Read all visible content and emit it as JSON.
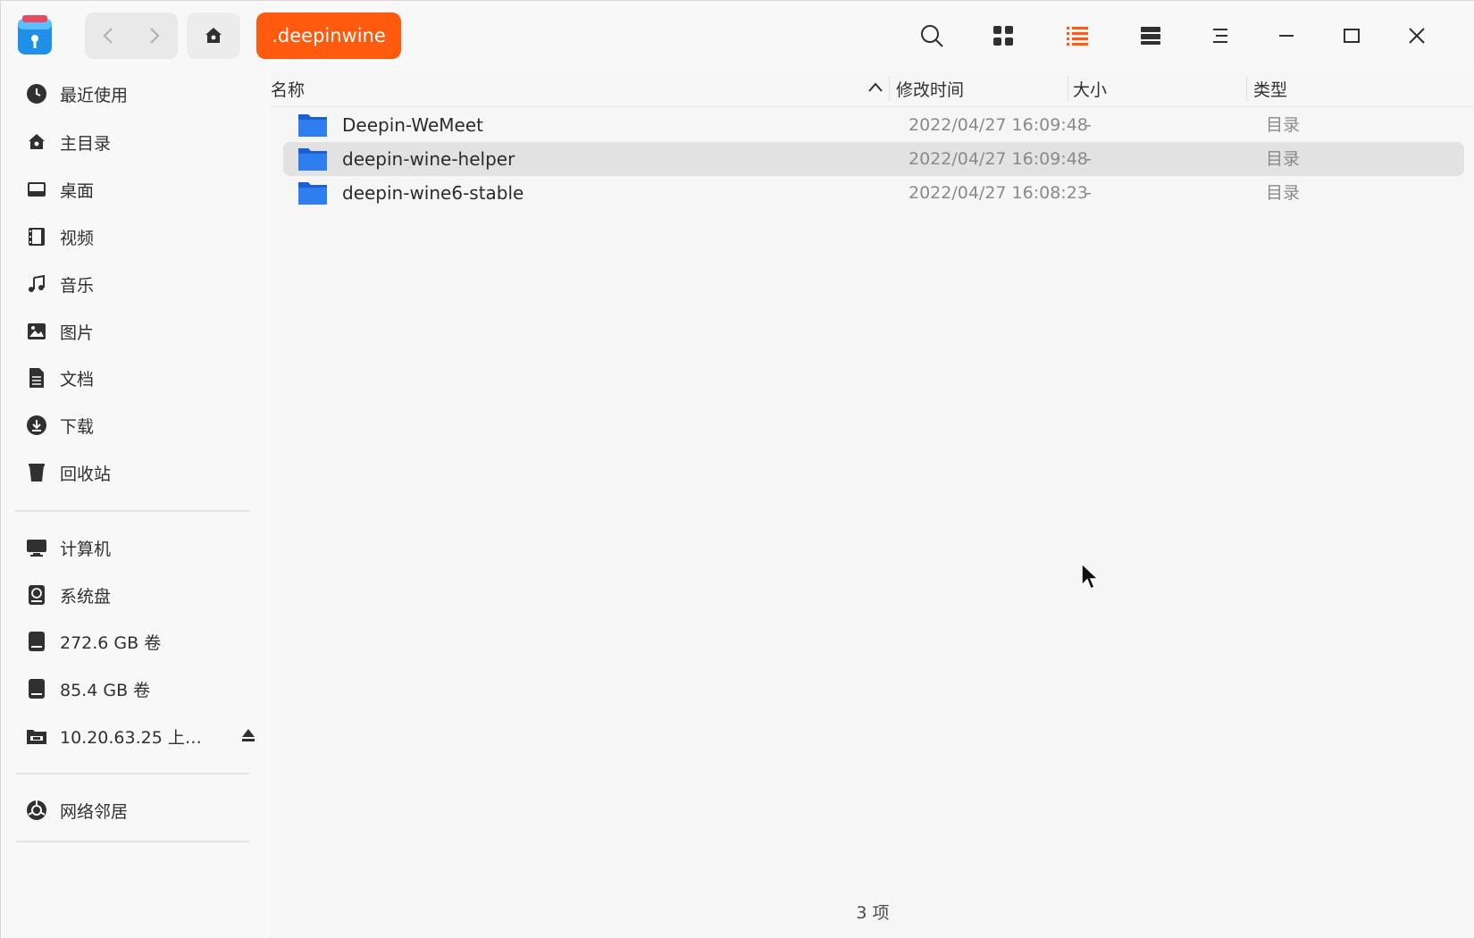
{
  "titlebar": {
    "breadcrumb": ".deepinwine",
    "icons": [
      "back-icon",
      "forward-icon",
      "home-icon",
      "search-icon",
      "icon-view-icon",
      "list-view-icon",
      "detail-view-icon",
      "menu-icon",
      "minimize-icon",
      "maximize-icon",
      "close-icon"
    ],
    "accent_color": "#ff5a0e"
  },
  "sidebar": {
    "items": [
      {
        "label": "最近使用",
        "icon": "clock-icon"
      },
      {
        "label": "主目录",
        "icon": "home-icon"
      },
      {
        "label": "桌面",
        "icon": "desktop-icon"
      },
      {
        "label": "视频",
        "icon": "video-icon"
      },
      {
        "label": "音乐",
        "icon": "music-icon"
      },
      {
        "label": "图片",
        "icon": "picture-icon"
      },
      {
        "label": "文档",
        "icon": "document-icon"
      },
      {
        "label": "下载",
        "icon": "download-icon"
      },
      {
        "label": "回收站",
        "icon": "trash-icon"
      }
    ],
    "devices": [
      {
        "label": "计算机",
        "icon": "computer-icon"
      },
      {
        "label": "系统盘",
        "icon": "system-disk-icon"
      },
      {
        "label": "272.6 GB 卷",
        "icon": "drive-icon"
      },
      {
        "label": "85.4 GB 卷",
        "icon": "drive-icon"
      },
      {
        "label": "10.20.63.25 上…",
        "icon": "network-share-icon"
      }
    ],
    "network": [
      {
        "label": "网络邻居",
        "icon": "network-icon"
      }
    ]
  },
  "columns": {
    "name": "名称",
    "modified": "修改时间",
    "size": "大小",
    "type": "类型"
  },
  "files": [
    {
      "name": "Deepin-WeMeet",
      "modified": "2022/04/27 16:09:48",
      "size": "-",
      "type": "目录"
    },
    {
      "name": "deepin-wine-helper",
      "modified": "2022/04/27 16:09:48",
      "size": "-",
      "type": "目录"
    },
    {
      "name": "deepin-wine6-stable",
      "modified": "2022/04/27 16:08:23",
      "size": "-",
      "type": "目录"
    }
  ],
  "status": {
    "count": "3 项"
  }
}
